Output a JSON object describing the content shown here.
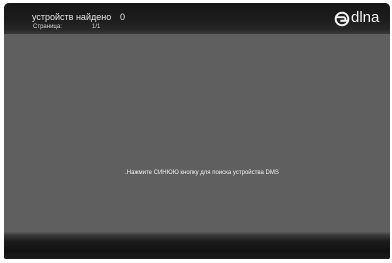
{
  "header": {
    "title": "устройств найдено",
    "device_count": "0",
    "page_label": "Страница:",
    "page_value": "1/1"
  },
  "logo": {
    "text": "dlna",
    "icon": "dlna-logo-icon"
  },
  "main": {
    "hint": ".Нажмите СИНЮЮ кнопку для поиска устройства DMS"
  },
  "colors": {
    "background": "#5f5f5f",
    "bar": "#161616",
    "text": "#e8e8e8"
  }
}
